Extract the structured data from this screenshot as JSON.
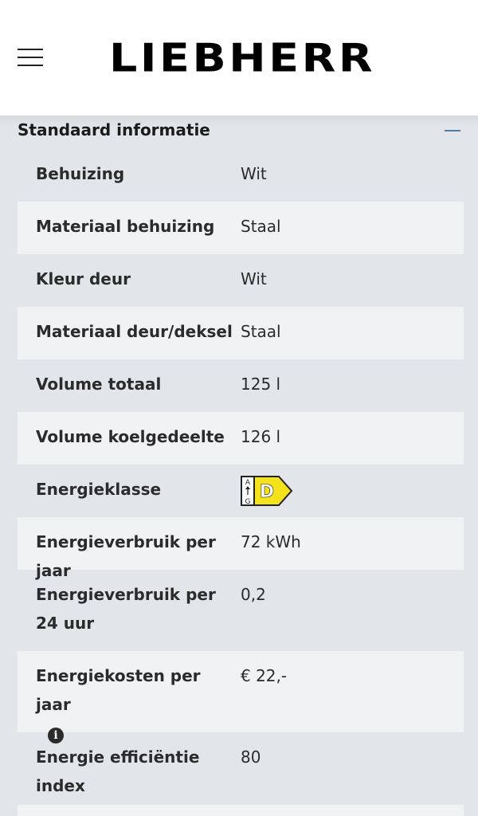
{
  "header": {
    "logo_text": "LIEBHERR"
  },
  "section": {
    "title": "Standaard informatie",
    "collapse_icon": "minus-icon"
  },
  "specs": [
    {
      "label": "Behuizing",
      "value": "Wit"
    },
    {
      "label": "Materiaal behuizing",
      "value": "Staal"
    },
    {
      "label": "Kleur deur",
      "value": "Wit"
    },
    {
      "label": "Materiaal deur/deksel",
      "value": "Staal"
    },
    {
      "label": "Volume totaal",
      "value": "125 l"
    },
    {
      "label": "Volume koelgedeelte",
      "value": "126 l"
    },
    {
      "label": "Energieklasse",
      "value": "D",
      "scale_top": "A",
      "scale_bottom": "G"
    },
    {
      "label": "Energieverbruik per jaar",
      "value": "72 kWh"
    },
    {
      "label": "Energieverbruik per 24 uur",
      "value": "0,2"
    },
    {
      "label": "Energiekosten per jaar",
      "value": "€ 22,-",
      "icon": "info-icon"
    },
    {
      "label": "Energie efficiëntie index",
      "value": "80"
    }
  ],
  "colors": {
    "accent": "#4a7fa8",
    "energy_class_fill": "#f4e21c",
    "row_alt": "#f1f2f4",
    "background": "#e2e6ea"
  }
}
